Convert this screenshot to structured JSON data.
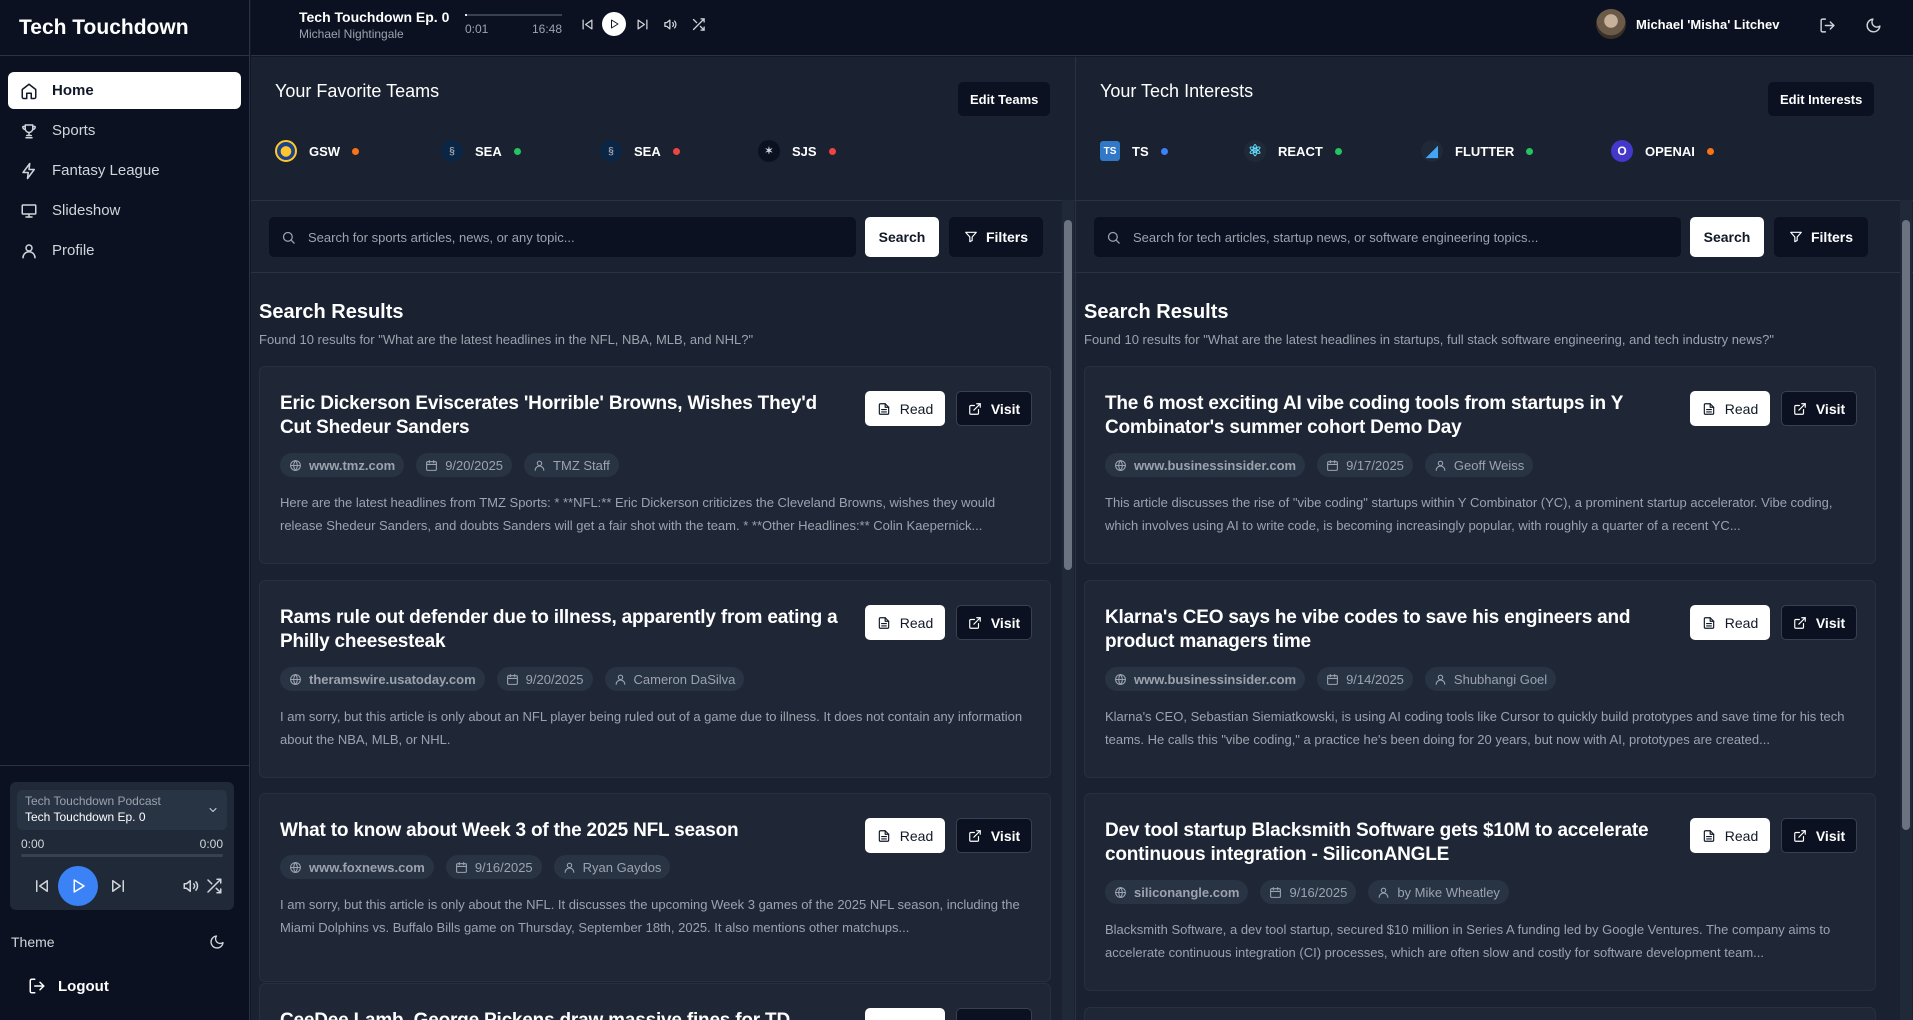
{
  "app": {
    "title": "Tech Touchdown"
  },
  "sidebar": {
    "items": [
      {
        "label": "Home",
        "icon": "home-icon"
      },
      {
        "label": "Sports",
        "icon": "trophy-icon"
      },
      {
        "label": "Fantasy League",
        "icon": "zap-icon"
      },
      {
        "label": "Slideshow",
        "icon": "presentation-icon"
      },
      {
        "label": "Profile",
        "icon": "user-icon"
      }
    ],
    "player": {
      "source": "Tech Touchdown Podcast",
      "episode": "Tech Touchdown Ep. 0",
      "current_time": "0:00",
      "duration": "0:00"
    },
    "theme_label": "Theme",
    "logout_label": "Logout"
  },
  "topbar": {
    "episode_title": "Tech Touchdown Ep. 0",
    "episode_author": "Michael Nightingale",
    "current_time": "0:01",
    "duration": "16:48",
    "progress": 0.001,
    "user_name": "Michael 'Misha' Litchev"
  },
  "left": {
    "header": "Your Favorite Teams",
    "edit_label": "Edit Teams",
    "chips": [
      {
        "label": "GSW",
        "dot_color": "#f97316"
      },
      {
        "label": "SEA",
        "dot_color": "#22c55e"
      },
      {
        "label": "SEA",
        "dot_color": "#ef4444"
      },
      {
        "label": "SJS",
        "dot_color": "#ef4444"
      }
    ],
    "search_placeholder": "Search for sports articles, news, or any topic...",
    "search_label": "Search",
    "filters_label": "Filters",
    "results_title": "Search Results",
    "results_subtitle": "Found 10 results for \"What are the latest headlines in the NFL, NBA, MLB, and NHL?\"",
    "articles": [
      {
        "title": "Eric Dickerson Eviscerates 'Horrible' Browns, Wishes They'd Cut Shedeur Sanders",
        "site": "www.tmz.com",
        "date": "9/20/2025",
        "author": "TMZ Staff",
        "desc": "Here are the latest headlines from TMZ Sports: * **NFL:** Eric Dickerson criticizes the Cleveland Browns, wishes they would release Shedeur Sanders, and doubts Sanders will get a fair shot with the team. * **Other Headlines:** Colin Kaepernick..."
      },
      {
        "title": "Rams rule out defender due to illness, apparently from eating a Philly cheesesteak",
        "site": "theramswire.usatoday.com",
        "date": "9/20/2025",
        "author": "Cameron DaSilva",
        "desc": "I am sorry, but this article is only about an NFL player being ruled out of a game due to illness. It does not contain any information about the NBA, MLB, or NHL."
      },
      {
        "title": "What to know about Week 3 of the 2025 NFL season",
        "site": "www.foxnews.com",
        "date": "9/16/2025",
        "author": "Ryan Gaydos",
        "desc": "I am sorry, but this article is only about the NFL. It discusses the upcoming Week 3 games of the 2025 NFL season, including the Miami Dolphins vs. Buffalo Bills game on Thursday, September 18th, 2025. It also mentions other matchups..."
      },
      {
        "title": "CeeDee Lamb, George Pickens draw massive fines for TD",
        "site": "",
        "date": "",
        "author": "",
        "desc": ""
      }
    ],
    "read_label": "Read",
    "visit_label": "Visit"
  },
  "right": {
    "header": "Your Tech Interests",
    "edit_label": "Edit Interests",
    "chips": [
      {
        "label": "TS",
        "dot_color": "#3b82f6"
      },
      {
        "label": "REACT",
        "dot_color": "#22c55e"
      },
      {
        "label": "FLUTTER",
        "dot_color": "#22c55e"
      },
      {
        "label": "OPENAI",
        "dot_color": "#f97316"
      }
    ],
    "search_placeholder": "Search for tech articles, startup news, or software engineering topics...",
    "search_label": "Search",
    "filters_label": "Filters",
    "results_title": "Search Results",
    "results_subtitle": "Found 10 results for \"What are the latest headlines in startups, full stack software engineering, and tech industry news?\"",
    "articles": [
      {
        "title": "The 6 most exciting AI vibe coding tools from startups in Y Combinator's summer cohort Demo Day",
        "site": "www.businessinsider.com",
        "date": "9/17/2025",
        "author": "Geoff Weiss",
        "desc": "This article discusses the rise of \"vibe coding\" startups within Y Combinator (YC), a prominent startup accelerator. Vibe coding, which involves using AI to write code, is becoming increasingly popular, with roughly a quarter of a recent YC..."
      },
      {
        "title": "Klarna's CEO says he vibe codes to save his engineers and product managers time",
        "site": "www.businessinsider.com",
        "date": "9/14/2025",
        "author": "Shubhangi Goel",
        "desc": "Klarna's CEO, Sebastian Siemiatkowski, is using AI coding tools like Cursor to quickly build prototypes and save time for his tech teams. He calls this \"vibe coding,\" a practice he's been doing for 20 years, but now with AI, prototypes are created..."
      },
      {
        "title": "Dev tool startup Blacksmith Software gets $10M to accelerate continuous integration - SiliconANGLE",
        "site": "siliconangle.com",
        "date": "9/16/2025",
        "author": "by Mike Wheatley",
        "desc": "Blacksmith Software, a dev tool startup, secured $10 million in Series A funding led by Google Ventures. The company aims to accelerate continuous integration (CI) processes, which are often slow and costly for software development team..."
      }
    ],
    "read_label": "Read",
    "visit_label": "Visit"
  },
  "colors": {
    "accent": "#3b82f6",
    "bg": "#111827",
    "panel": "#1a2130",
    "card": "#1f2737"
  }
}
